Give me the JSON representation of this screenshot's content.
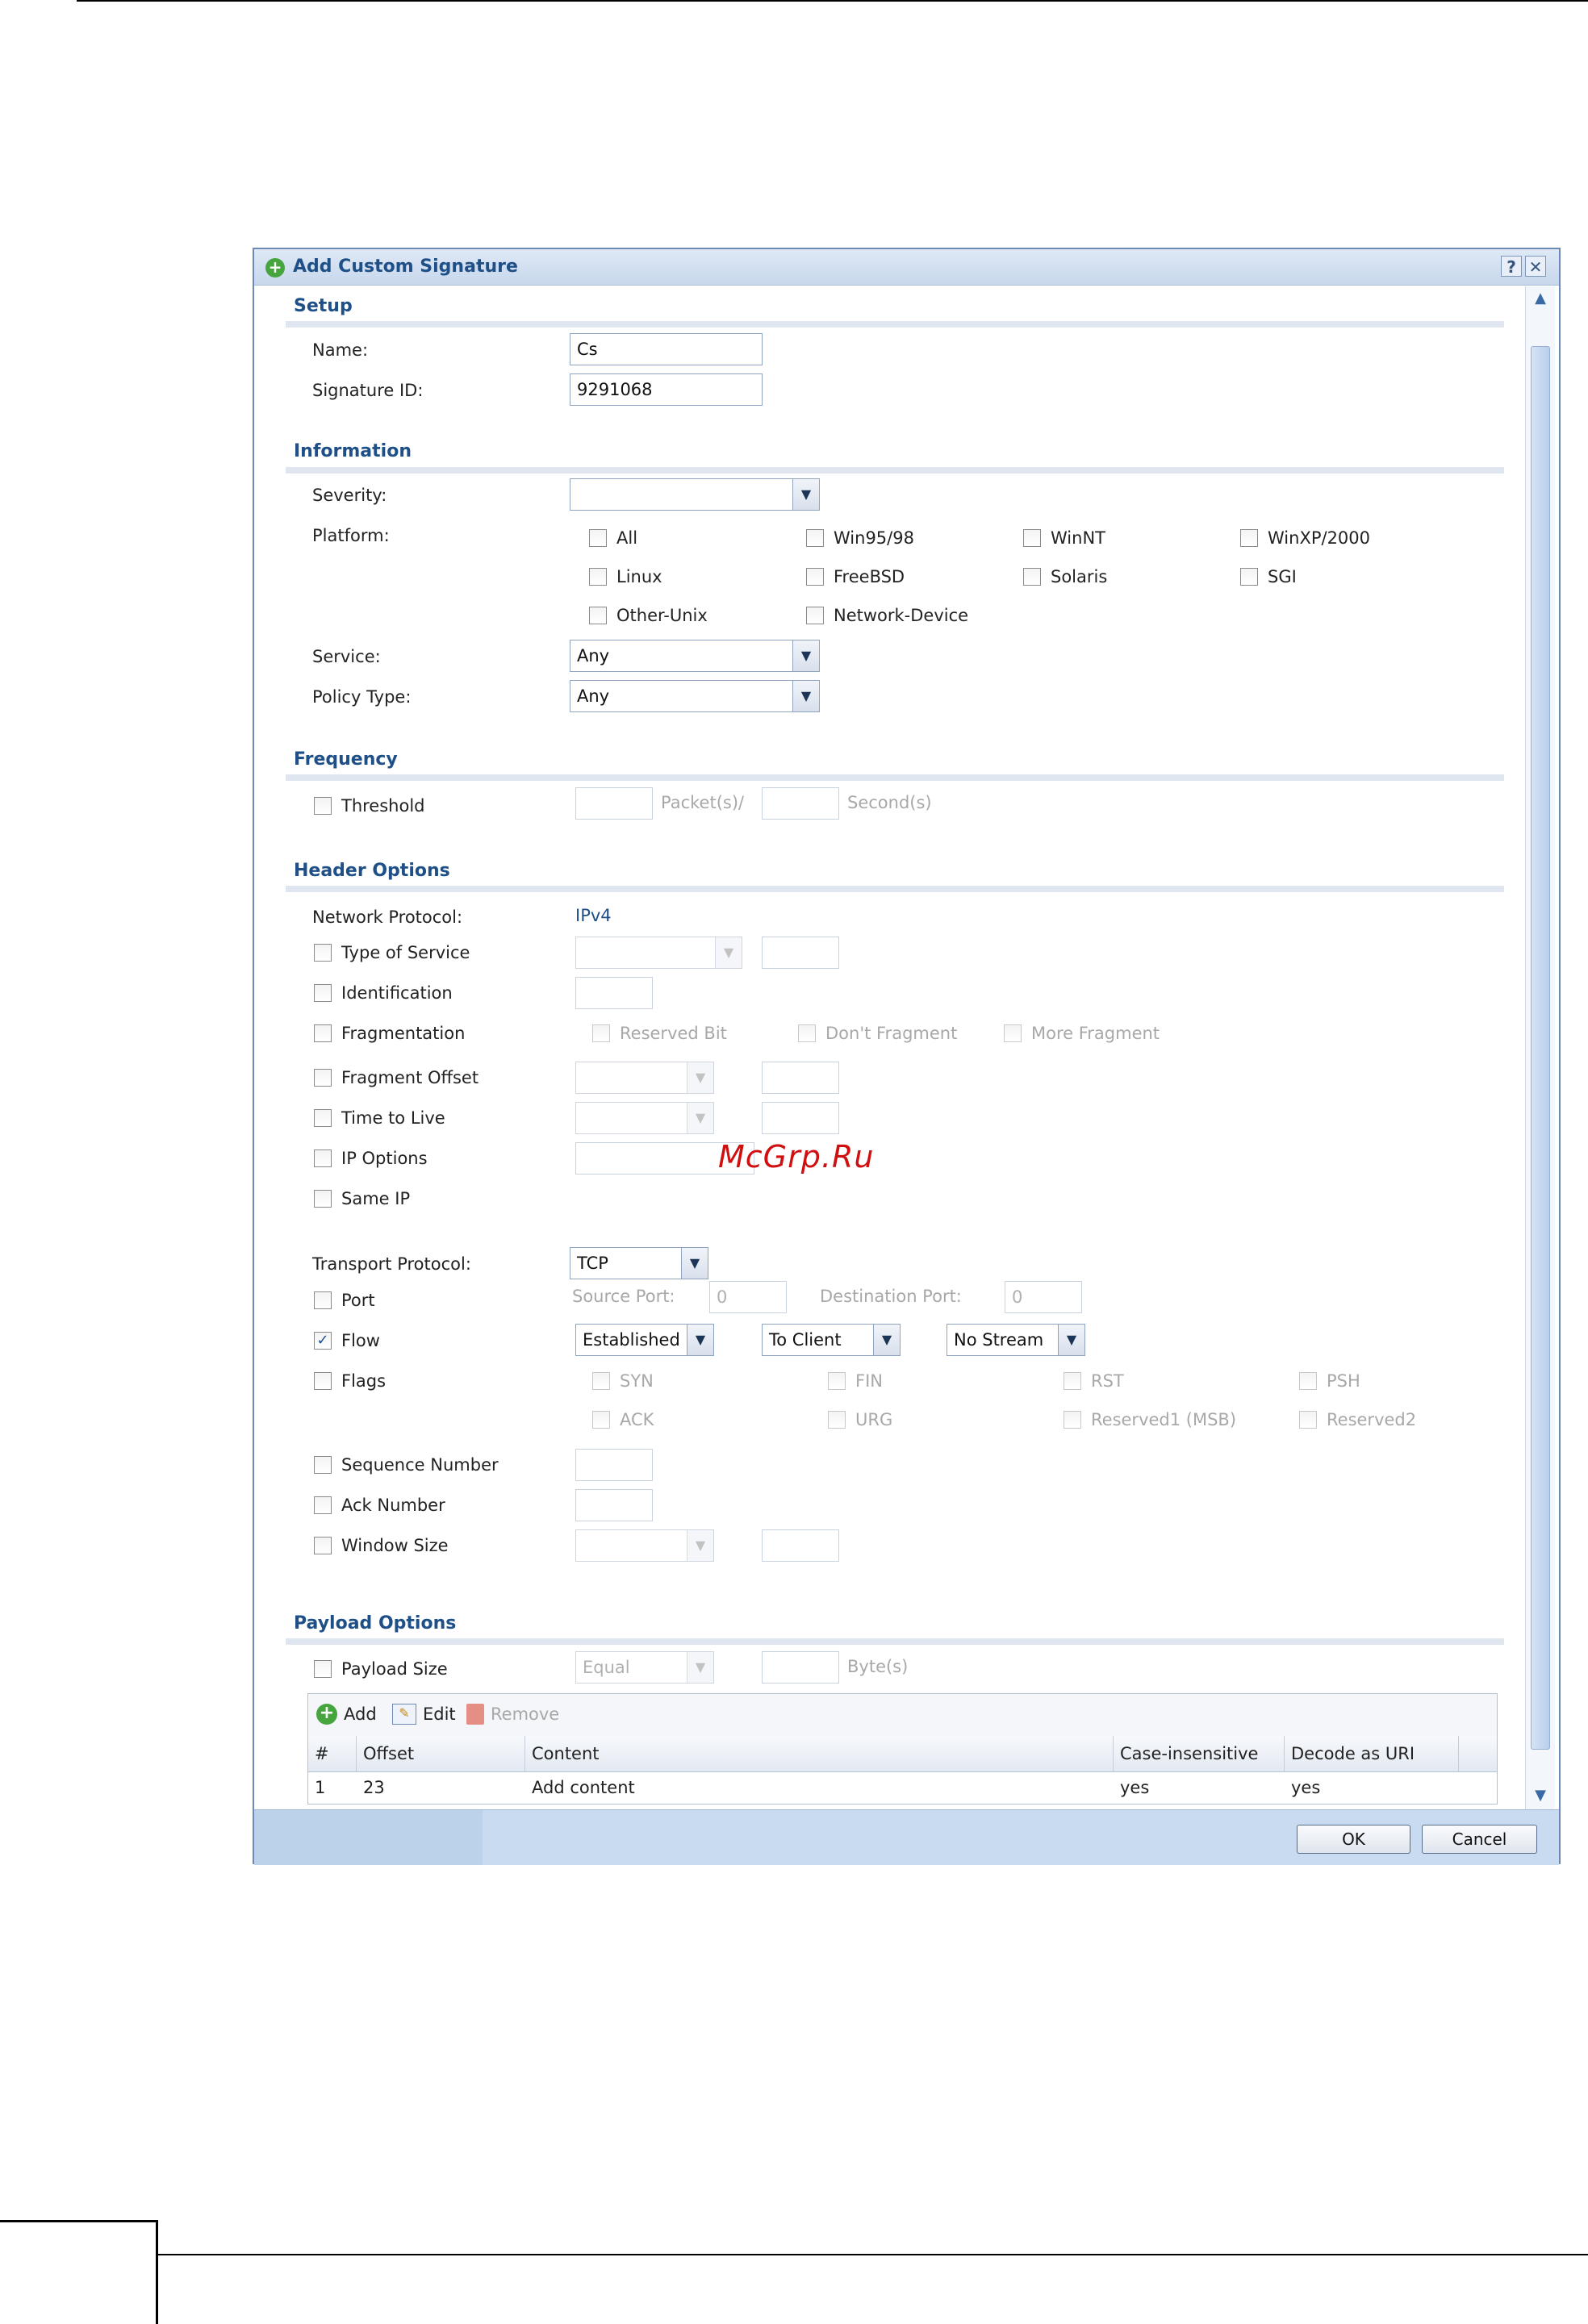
{
  "dialog": {
    "title": "Add Custom Signature",
    "help_label": "?",
    "close_label": "✕",
    "ok_label": "OK",
    "cancel_label": "Cancel"
  },
  "setup": {
    "heading": "Setup",
    "name_label": "Name:",
    "name_value": "Cs",
    "sigid_label": "Signature ID:",
    "sigid_value": "9291068"
  },
  "information": {
    "heading": "Information",
    "severity_label": "Severity:",
    "severity_value": "",
    "platform_label": "Platform:",
    "platforms": [
      "All",
      "Win95/98",
      "WinNT",
      "WinXP/2000",
      "Linux",
      "FreeBSD",
      "Solaris",
      "SGI",
      "Other-Unix",
      "Network-Device"
    ],
    "service_label": "Service:",
    "service_value": "Any",
    "policy_label": "Policy Type:",
    "policy_value": "Any"
  },
  "frequency": {
    "heading": "Frequency",
    "threshold_label": "Threshold",
    "packets_label": "Packet(s)/",
    "seconds_label": "Second(s)"
  },
  "header_options": {
    "heading": "Header Options",
    "network_protocol_label": "Network Protocol:",
    "network_protocol_value": "IPv4",
    "tos_label": "Type of Service",
    "identification_label": "Identification",
    "fragmentation_label": "Fragmentation",
    "reserved_bit_label": "Reserved Bit",
    "dont_fragment_label": "Don't Fragment",
    "more_fragment_label": "More Fragment",
    "fragment_offset_label": "Fragment Offset",
    "ttl_label": "Time to Live",
    "ip_options_label": "IP Options",
    "same_ip_label": "Same IP",
    "transport_label": "Transport Protocol:",
    "transport_value": "TCP",
    "port_label": "Port",
    "source_port_label": "Source Port:",
    "source_port_value": "0",
    "dest_port_label": "Destination Port:",
    "dest_port_value": "0",
    "flow_label": "Flow",
    "flow_state": "Established",
    "flow_direction": "To Client",
    "flow_stream": "No Stream",
    "flags_label": "Flags",
    "flags": [
      "SYN",
      "FIN",
      "RST",
      "PSH",
      "ACK",
      "URG",
      "Reserved1 (MSB)",
      "Reserved2"
    ],
    "seq_label": "Sequence Number",
    "ack_label": "Ack Number",
    "window_label": "Window Size"
  },
  "payload": {
    "heading": "Payload Options",
    "size_label": "Payload Size",
    "size_op": "Equal",
    "bytes_label": "Byte(s)",
    "add_label": "Add",
    "edit_label": "Edit",
    "remove_label": "Remove",
    "columns": [
      "#",
      "Offset",
      "Content",
      "Case-insensitive",
      "Decode as URI"
    ],
    "rows": [
      {
        "num": "1",
        "offset": "23",
        "content": "Add content",
        "case": "yes",
        "decode": "yes"
      }
    ]
  },
  "watermark": "McGrp.Ru"
}
